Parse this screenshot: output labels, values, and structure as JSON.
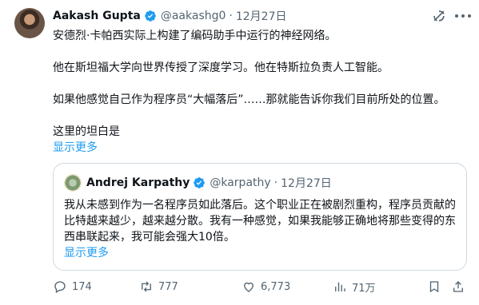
{
  "tweet": {
    "author_name": "Aakash Gupta",
    "handle": "@aakashg0",
    "separator": "·",
    "date": "12月27日",
    "paragraphs": [
      "安德烈·卡帕西实际上构建了编码助手中运行的神经网络。",
      "他在斯坦福大学向世界传授了深度学习。他在特斯拉负责人工智能。",
      "如果他感觉自己作为程序员“大幅落后”……那就能告诉你我们目前所处的位置。",
      "这里的坦白是"
    ],
    "show_more": "显示更多"
  },
  "quote": {
    "author_name": "Andrej Karpathy",
    "handle": "@karpathy",
    "separator": "·",
    "date": "12月27日",
    "text": "我从未感到作为一名程序员如此落后。这个职业正在被剧烈重构，程序员贡献的比特越来越少，越来越分散。我有一种感觉，如果我能够正确地将那些变得的东西串联起来，我可能会强大10倍。",
    "show_more": "显示更多"
  },
  "actions": {
    "replies": "174",
    "retweets": "777",
    "likes": "6,773",
    "views": "71万"
  },
  "colors": {
    "link": "#1d9bf0",
    "muted": "#536471",
    "border": "#cfd9de",
    "verified": "#1d9bf0"
  },
  "icons": [
    "verified-badge-icon",
    "grok-icon",
    "more-icon",
    "reply-icon",
    "retweet-icon",
    "like-icon",
    "views-icon",
    "bookmark-icon",
    "share-icon"
  ]
}
